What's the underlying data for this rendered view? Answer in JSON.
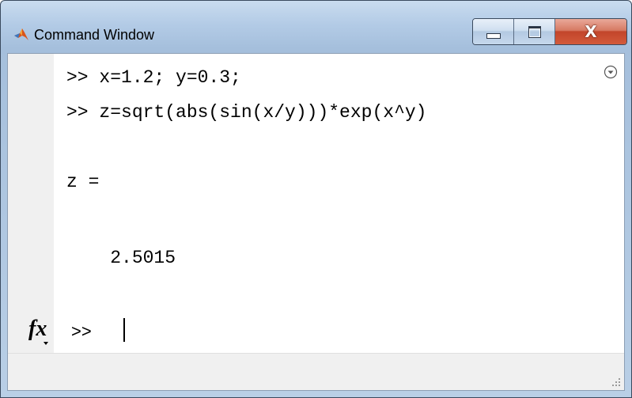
{
  "window": {
    "title": "Command Window",
    "icon": "matlab-logo-icon"
  },
  "caption_buttons": {
    "minimize": "minimize-icon",
    "maximize": "maximize-icon",
    "close": "close-icon"
  },
  "colors": {
    "titlebar": "#b3cbe6",
    "close_button": "#c2452a",
    "console_background": "#ffffff",
    "gutter": "#f0f0f0",
    "text": "#000000"
  },
  "console": {
    "lines": [
      ">> x=1.2; y=0.3;",
      ">> z=sqrt(abs(sin(x/y)))*exp(x^y)",
      "",
      "z =",
      "",
      "    2.5015"
    ],
    "prompt": ">>",
    "input_value": ""
  },
  "function_browser_icon": "fx-icon",
  "options_icon": "options-circle-icon"
}
